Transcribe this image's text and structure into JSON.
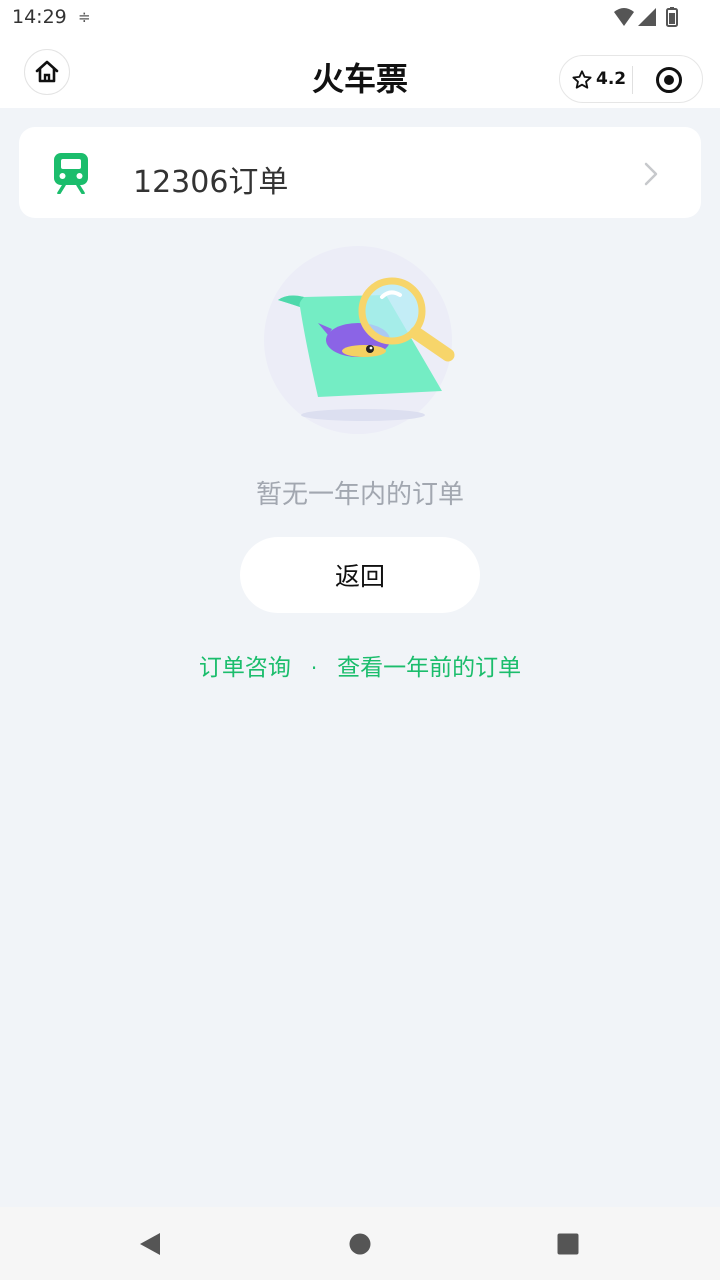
{
  "status_bar": {
    "time": "14:29",
    "settings_icon": "≑",
    "icons": [
      "wifi-icon",
      "signal-icon",
      "battery-icon"
    ]
  },
  "nav": {
    "title": "火车票",
    "rating": "4.2",
    "home_icon": "home-icon",
    "star_icon": "star-icon",
    "target_icon": "target-icon"
  },
  "order_card": {
    "label": "12306订单",
    "icon": "train-icon",
    "chevron": "chevron-right-icon"
  },
  "empty_state": {
    "illustration": "magnifier-scroll-illustration",
    "message": "暂无一年内的订单"
  },
  "back_button": {
    "label": "返回"
  },
  "links": {
    "consult": "订单咨询",
    "separator": "·",
    "older_orders": "查看一年前的订单"
  },
  "system_nav": {
    "icons": [
      "back-triangle-icon",
      "home-circle-icon",
      "recents-square-icon"
    ]
  },
  "colors": {
    "accent_green": "#1bbd6c",
    "page_bg": "#f1f4f8",
    "muted_text": "#a2a7b0"
  }
}
